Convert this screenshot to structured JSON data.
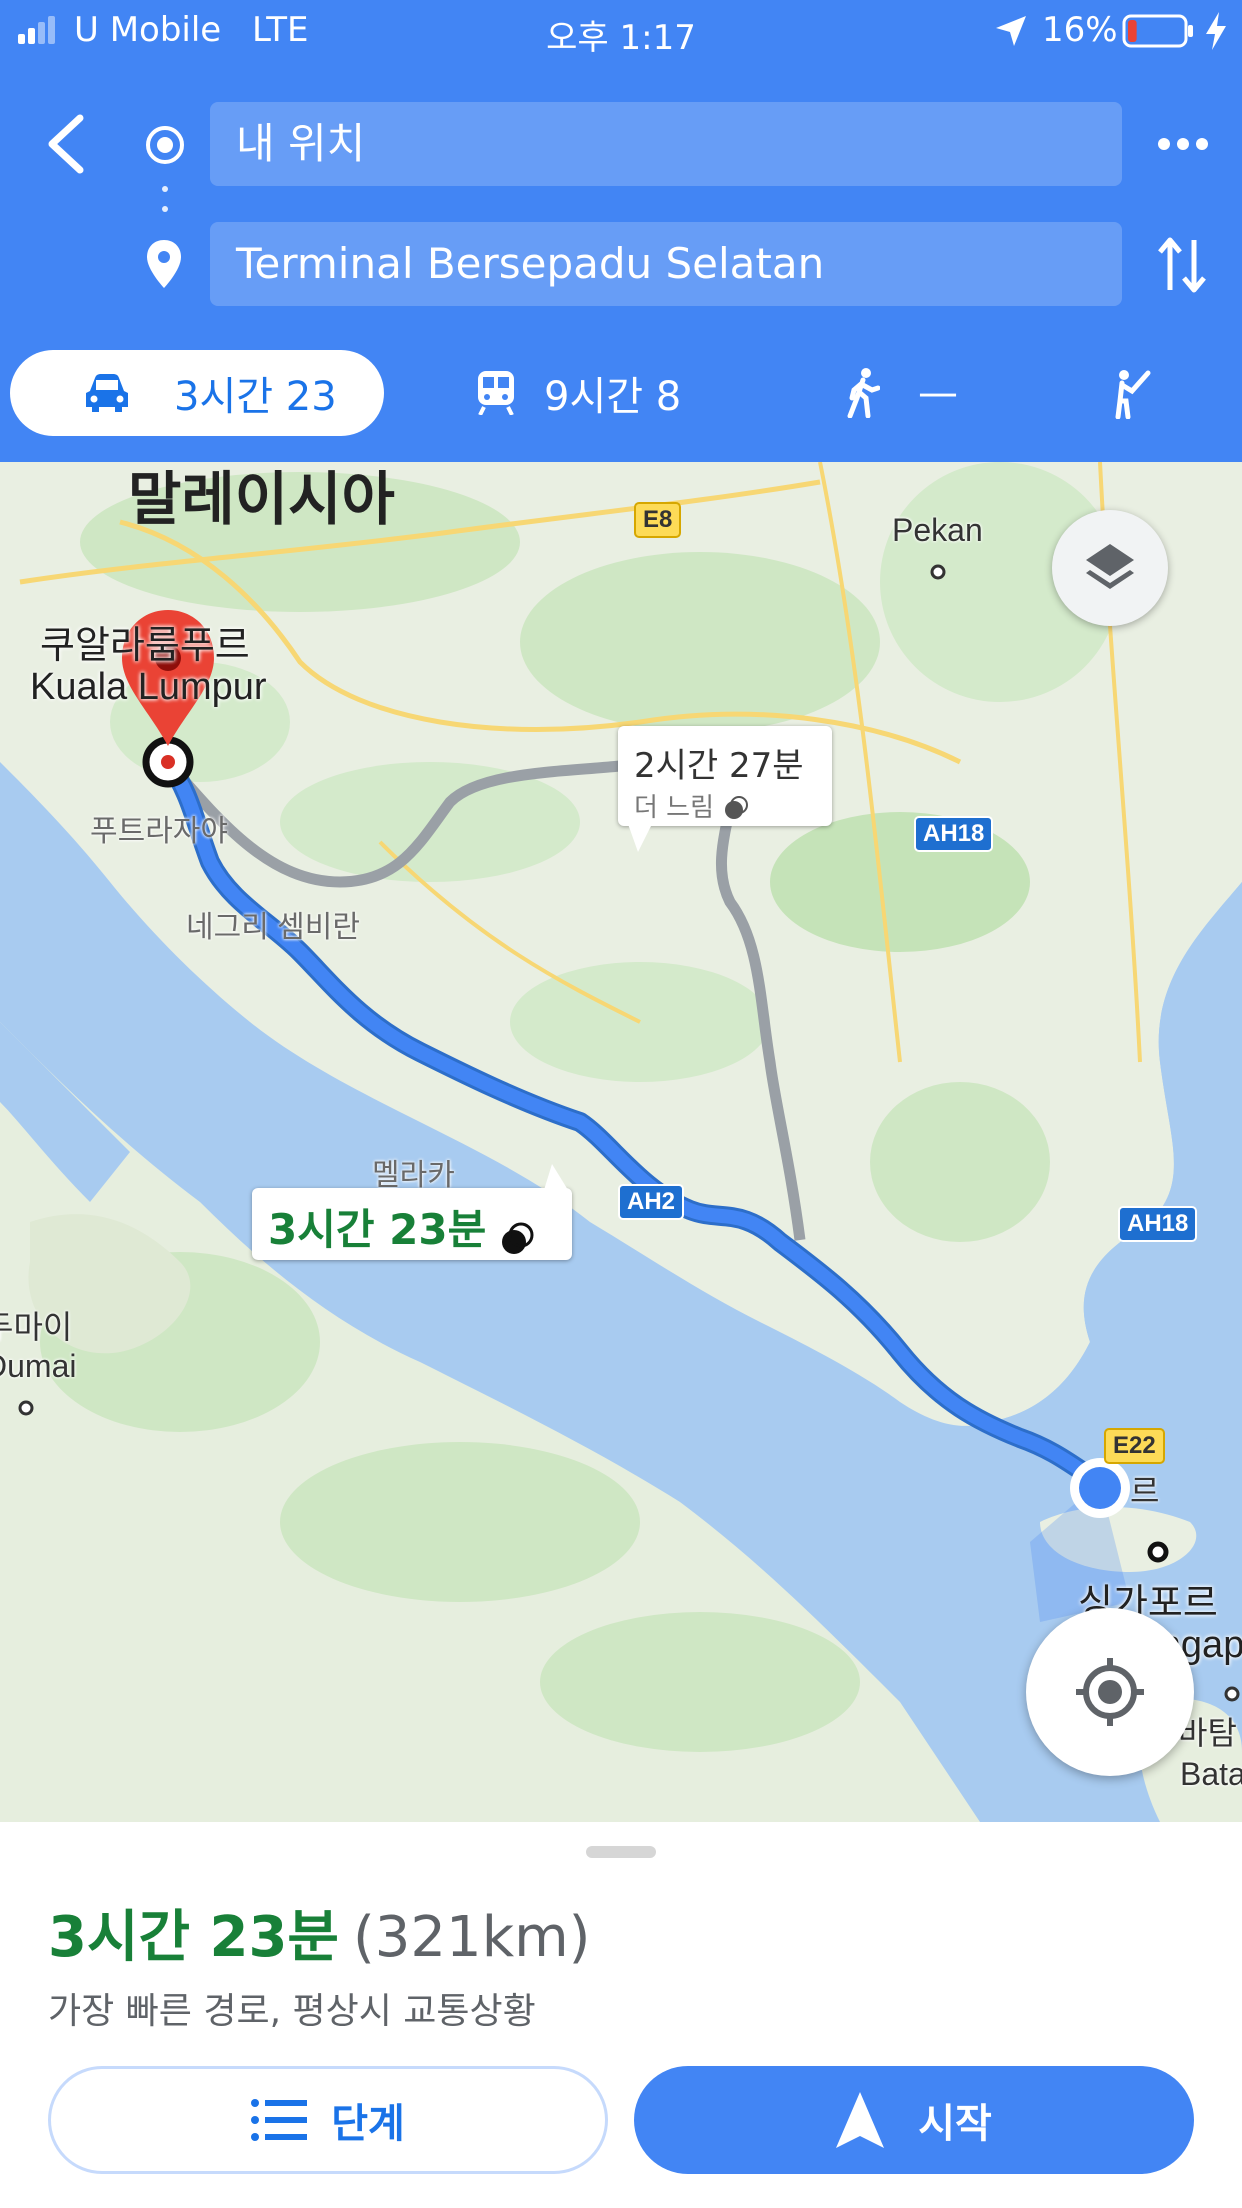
{
  "status_bar": {
    "carrier": "U Mobile",
    "network": "LTE",
    "time": "오후 1:17",
    "battery_percent": "16%",
    "battery_level": 0.16,
    "battery_color": "#ea4335"
  },
  "directions": {
    "origin": "내 위치",
    "destination": "Terminal Bersepadu Selatan"
  },
  "modes": [
    {
      "icon": "car-icon",
      "label": "3시간 23",
      "selected": true
    },
    {
      "icon": "train-icon",
      "label": "9시간 8",
      "selected": false
    },
    {
      "icon": "walk-icon",
      "label": "—",
      "selected": false
    },
    {
      "icon": "ride-hail-icon",
      "label": "",
      "selected": false
    }
  ],
  "map": {
    "labels": {
      "country": "말레이시아",
      "kl_korean": "쿠알라룸푸르",
      "kl_english": "Kuala Lumpur",
      "putrajaya": "푸트라자야",
      "negeri": "네그리 셈비란",
      "melaka": "멜라카",
      "pekan": "Pekan",
      "dumai_korean": "두마이",
      "dumai_english": "Dumai",
      "singapore_korean": "싱가포르",
      "singapore_english": "Singapore",
      "batam_korean": "바탐",
      "batam_english": "Batam",
      "johor_partial": "르"
    },
    "shields": {
      "e8": "E8",
      "ah18_top": "AH18",
      "ah18_bottom": "AH18",
      "ah2": "AH2",
      "e22": "E22"
    },
    "alt_route": {
      "duration": "2시간 27분",
      "note": "더 느림"
    },
    "main_route": {
      "duration": "3시간 23분"
    },
    "route_color": "#4285f4",
    "alt_route_color": "#9aa0a6"
  },
  "sheet": {
    "duration": "3시간 23분",
    "distance": "(321km)",
    "description": "가장 빠른 경로, 평상시 교통상황",
    "steps_label": "단계",
    "start_label": "시작"
  }
}
